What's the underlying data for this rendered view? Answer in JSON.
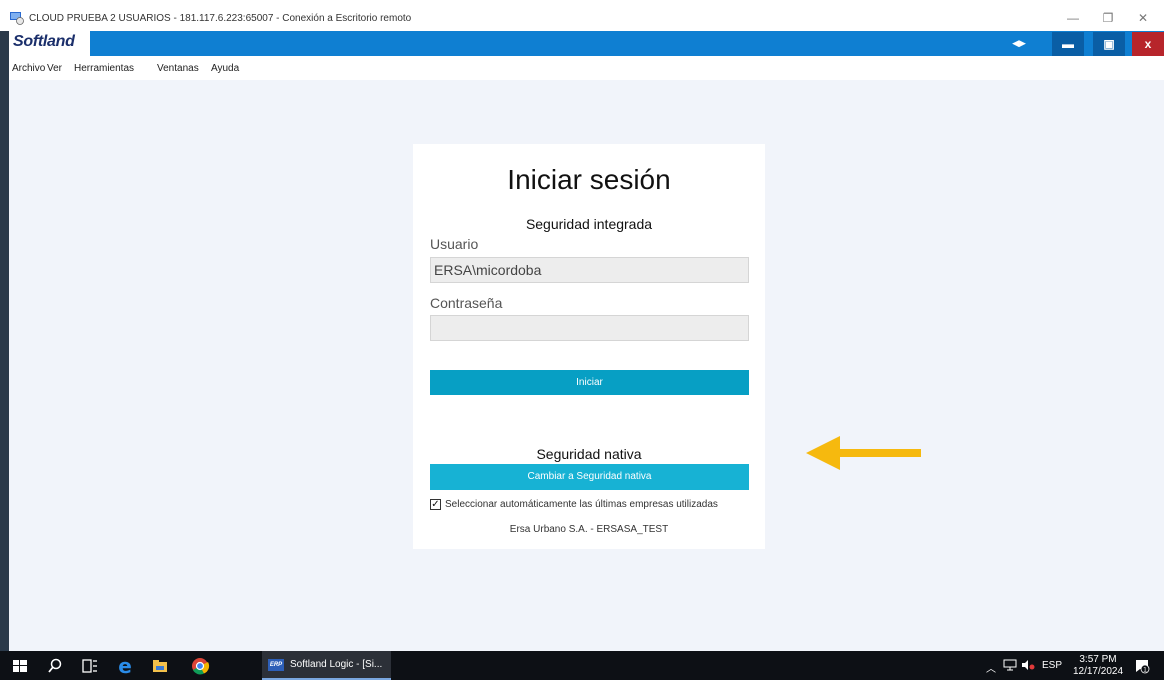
{
  "window": {
    "title": "CLOUD PRUEBA 2 USUARIOS - 181.117.6.223:65007 - Conexión a Escritorio remoto",
    "minimize": "—",
    "restore": "❐",
    "close": "✕"
  },
  "app": {
    "logo": "Softland",
    "header_arrows": "◀▶",
    "minimize": "▬",
    "restore": "▣",
    "close": "x"
  },
  "menu": {
    "items": [
      "Archivo",
      "Ver",
      "Herramientas",
      "Ventanas",
      "Ayuda"
    ]
  },
  "login": {
    "title": "Iniciar sesión",
    "integrated_heading": "Seguridad integrada",
    "user_label": "Usuario",
    "user_value": "ERSA\\micordoba",
    "password_label": "Contraseña",
    "password_value": "",
    "submit_label": "Iniciar",
    "native_heading": "Seguridad nativa",
    "native_button": "Cambiar a Seguridad nativa",
    "auto_select_checked": true,
    "auto_select_label": "Seleccionar automáticamente las últimas empresas utilizadas",
    "company": "Ersa Urbano S.A. - ERSASA_TEST"
  },
  "annotation": {
    "arrow_color": "#f6b90e"
  },
  "taskbar": {
    "app_icon": "ERP",
    "app_label": "Softland Logic - [Si...",
    "language": "ESP",
    "time": "3:57 PM",
    "date": "12/17/2024",
    "notifications": "1"
  },
  "colors": {
    "header_blue": "#0f7fd2",
    "button_primary": "#079fc4",
    "button_secondary": "#17b2d4",
    "close_red": "#b7252b"
  }
}
